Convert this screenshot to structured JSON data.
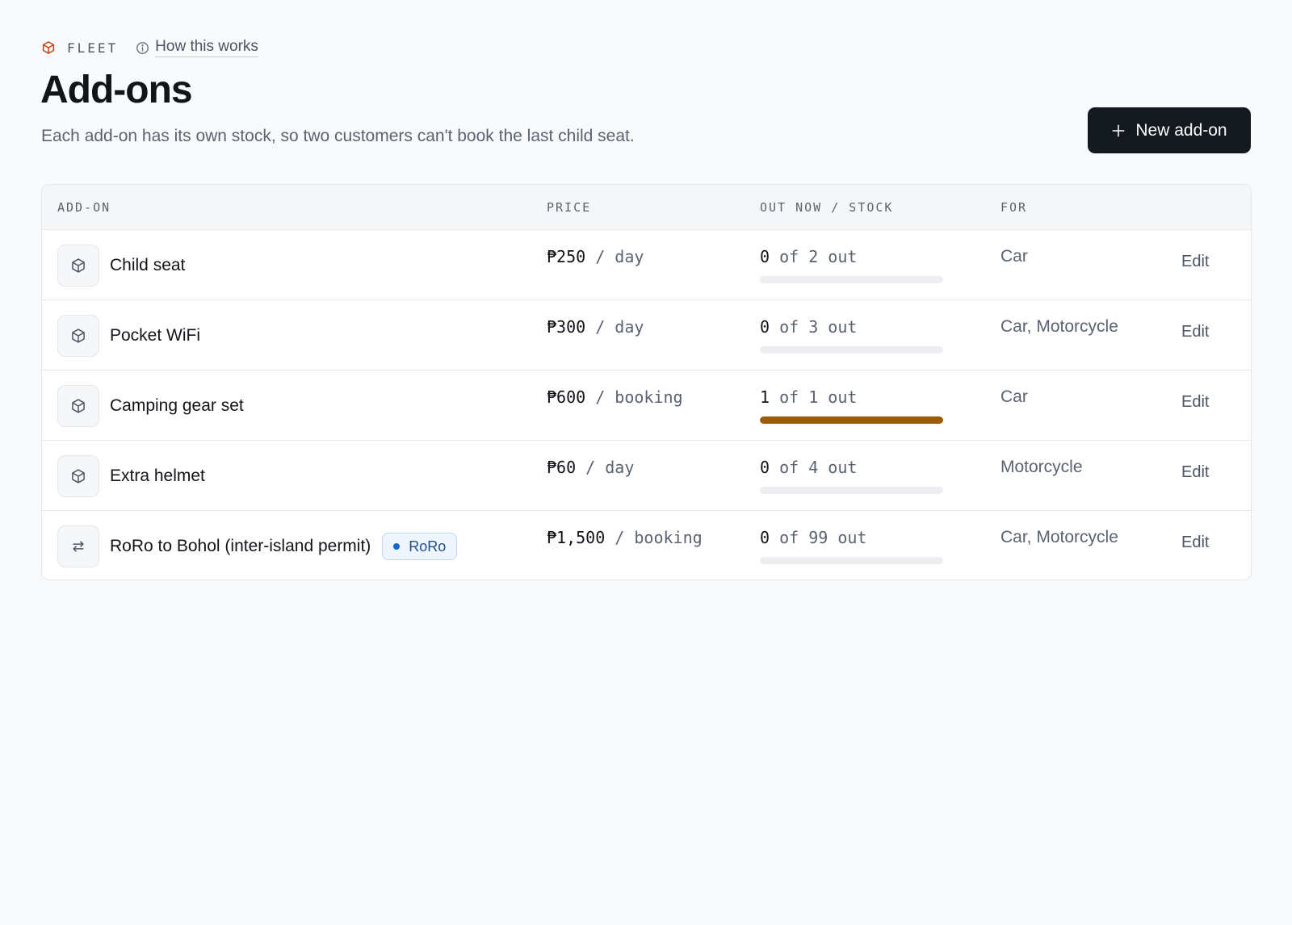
{
  "header": {
    "section_label": "FLEET",
    "section_icon": "cube-icon",
    "help_label": "How this works",
    "help_icon": "info-icon",
    "title": "Add-ons",
    "subtitle": "Each add-on has its own stock, so two customers can't book the last child seat.",
    "new_button_label": "New add-on",
    "new_button_icon": "plus-icon"
  },
  "colors": {
    "brand_icon": "#c2410c",
    "primary_button": "#14181f",
    "stock_bar_fill": "#9a5c06",
    "badge_dot": "#1d63c1"
  },
  "table": {
    "columns": [
      "ADD-ON",
      "PRICE",
      "OUT NOW / STOCK",
      "FOR"
    ],
    "rows": [
      {
        "icon": "cube-icon",
        "name": "Child seat",
        "badge": null,
        "price": "₱250",
        "unit": "/ day",
        "out": "0",
        "stock_text": "of 2 out",
        "out_count": 0,
        "stock_count": 2,
        "for": "Car",
        "action": "Edit"
      },
      {
        "icon": "cube-icon",
        "name": "Pocket WiFi",
        "badge": null,
        "price": "₱300",
        "unit": "/ day",
        "out": "0",
        "stock_text": "of 3 out",
        "out_count": 0,
        "stock_count": 3,
        "for": "Car, Motorcycle",
        "action": "Edit"
      },
      {
        "icon": "cube-icon",
        "name": "Camping gear set",
        "badge": null,
        "price": "₱600",
        "unit": "/ booking",
        "out": "1",
        "stock_text": "of 1 out",
        "out_count": 1,
        "stock_count": 1,
        "for": "Car",
        "action": "Edit"
      },
      {
        "icon": "cube-icon",
        "name": "Extra helmet",
        "badge": null,
        "price": "₱60",
        "unit": "/ day",
        "out": "0",
        "stock_text": "of 4 out",
        "out_count": 0,
        "stock_count": 4,
        "for": "Motorcycle",
        "action": "Edit"
      },
      {
        "icon": "arrows-exchange-icon",
        "name": "RoRo to Bohol (inter-island permit)",
        "badge": "RoRo",
        "price": "₱1,500",
        "unit": "/ booking",
        "out": "0",
        "stock_text": "of 99 out",
        "out_count": 0,
        "stock_count": 99,
        "for": "Car, Motorcycle",
        "action": "Edit"
      }
    ]
  }
}
